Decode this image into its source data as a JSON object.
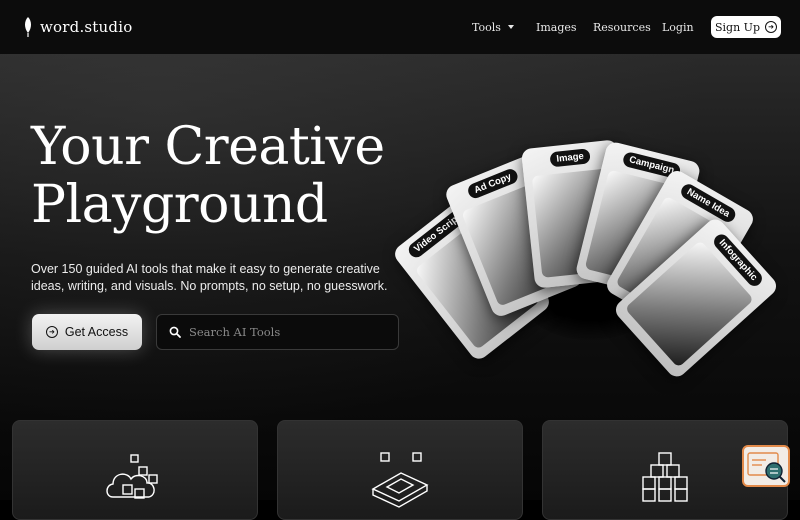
{
  "header": {
    "brand": "word.studio",
    "nav": {
      "tools": "Tools",
      "images": "Images",
      "resources": "Resources",
      "login": "Login"
    },
    "signup_label": "Sign Up"
  },
  "hero": {
    "title": "Your Creative Playground",
    "subtitle": "Over 150 guided AI tools that make it easy to generate creative ideas, writing, and visuals. No prompts, no setup, no guesswork.",
    "cta_label": "Get Access",
    "search_placeholder": "Search AI Tools"
  },
  "fan_cards": [
    {
      "label": "Video Script"
    },
    {
      "label": "Ad Copy"
    },
    {
      "label": "Image"
    },
    {
      "label": "Campaign"
    },
    {
      "label": "Name Idea"
    },
    {
      "label": "Infographic"
    }
  ],
  "features": [
    {
      "icon": "cubes-cloud-icon"
    },
    {
      "icon": "cube-layout-icon"
    },
    {
      "icon": "stacked-cubes-icon"
    }
  ],
  "colors": {
    "background": "#000000",
    "accent_chat": "#e28a4a"
  }
}
